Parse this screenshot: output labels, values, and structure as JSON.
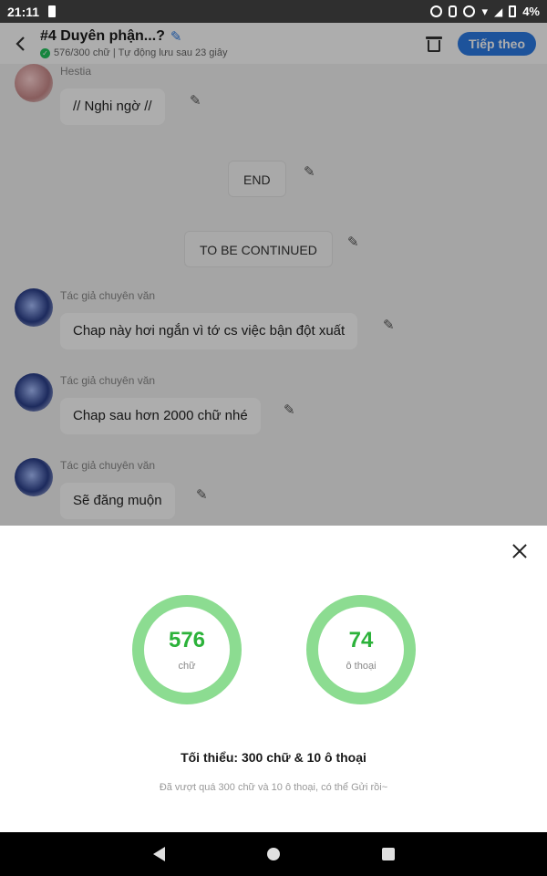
{
  "status_bar": {
    "time": "21:11",
    "battery": "4%"
  },
  "header": {
    "title": "#4 Duyên phận...?",
    "word_status": "576/300 chữ | Tự động lưu sau 23 giây",
    "next_label": "Tiếp theo"
  },
  "chat": {
    "messages": [
      {
        "sender": "Hestia",
        "text": "// Nghi ngờ //"
      },
      {
        "text": "END"
      },
      {
        "text": "TO BE CONTINUED"
      },
      {
        "sender": "Tác giả chuyên văn",
        "text": "Chap này hơi ngắn vì tớ cs việc bận đột xuất"
      },
      {
        "sender": "Tác giả chuyên văn",
        "text": "Chap sau hơn 2000 chữ nhé"
      },
      {
        "sender": "Tác giả chuyên văn",
        "text": "Sẽ đăng muộn"
      }
    ]
  },
  "sheet": {
    "stats": [
      {
        "value": "576",
        "unit": "chữ"
      },
      {
        "value": "74",
        "unit": "ô thoại"
      }
    ],
    "minimum": "Tối thiểu: 300 chữ & 10 ô thoại",
    "hint": "Đã vượt quá 300 chữ và 10 ô thoại, có thể Gửi rồi~"
  },
  "colors": {
    "accent": "#2c7be5",
    "ring": "#8cdc91",
    "ring_text": "#2cb23a"
  }
}
